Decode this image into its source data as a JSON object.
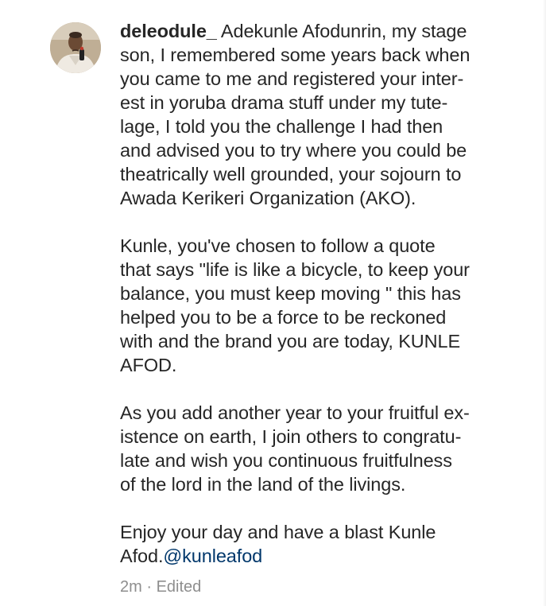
{
  "comment": {
    "username": "deleodule_",
    "paragraphs": [
      {
        "lines": [
          "Adekunle Afodunrin, my stage",
          "son, I remembered some years back when",
          "you came to me and registered your inter-",
          "est in yoruba drama stuff under my tute-",
          "lage, I told you the challenge I had then",
          "and advised you to try where you could be",
          "theatrically well grounded, your sojourn to",
          "Awada Kerikeri Organization (AKO)."
        ]
      },
      {
        "lines": [
          "Kunle, you've chosen to follow a quote",
          "that says \"life is like a bicycle, to keep your",
          "balance, you must keep moving \" this has",
          "helped you to be a force to be reckoned",
          "with and the brand you are today, KUNLE",
          "AFOD."
        ]
      },
      {
        "lines": [
          "As you add another year to your fruitful ex-",
          "istence on earth, I join others to congratu-",
          "late and wish you continuous fruitfulness",
          "of the lord in the land of the livings."
        ]
      },
      {
        "lines": [
          "Enjoy your day and have a blast Kunle"
        ],
        "last_line_prefix": "Afod.",
        "mention": "@kunleafod"
      }
    ],
    "meta": {
      "time": "2m",
      "separator": "·",
      "edited": "Edited"
    }
  },
  "colors": {
    "text": "#262626",
    "mention": "#00376b",
    "meta": "#8e8e8e"
  },
  "icons": {
    "avatar": "profile-photo"
  }
}
